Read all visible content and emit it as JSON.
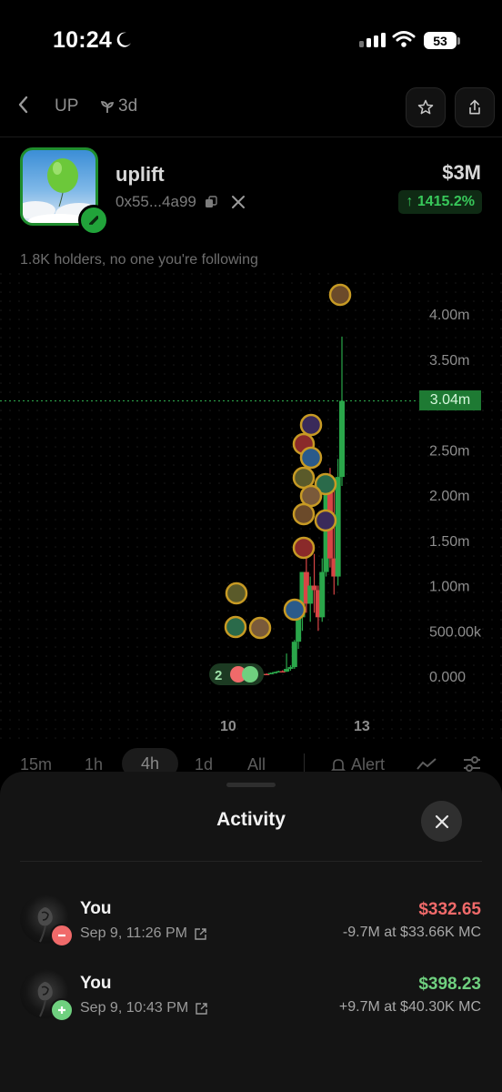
{
  "status_bar": {
    "time": "10:24",
    "battery": "53"
  },
  "nav": {
    "ticker": "UP",
    "age": "3d"
  },
  "token": {
    "name": "uplift",
    "address": "0x55...4a99",
    "market_cap": "$3M",
    "change": "↑ 1415.2%",
    "holders_text": "1.8K holders, no one you're following"
  },
  "chart_data": {
    "type": "candlestick",
    "y_tick_labels": [
      "4.00m",
      "3.50m",
      "3.04m",
      "2.50m",
      "2.00m",
      "1.50m",
      "1.00m",
      "500.00k",
      "0.000"
    ],
    "y_ticks": [
      4000000,
      3500000,
      2500000,
      2000000,
      1500000,
      1000000,
      500000,
      0
    ],
    "current_price": 3040000,
    "current_price_label": "3.04m",
    "x_tick_labels": [
      "10",
      "13"
    ],
    "ylim": [
      0,
      4200000
    ],
    "candles": [
      {
        "o": 20000,
        "h": 30000,
        "l": 15000,
        "c": 25000
      },
      {
        "o": 25000,
        "h": 30000,
        "l": 18000,
        "c": 22000
      },
      {
        "o": 22000,
        "h": 40000,
        "l": 20000,
        "c": 35000
      },
      {
        "o": 35000,
        "h": 50000,
        "l": 30000,
        "c": 45000
      },
      {
        "o": 45000,
        "h": 60000,
        "l": 40000,
        "c": 55000
      },
      {
        "o": 55000,
        "h": 65000,
        "l": 45000,
        "c": 50000
      },
      {
        "o": 50000,
        "h": 250000,
        "l": 45000,
        "c": 80000
      },
      {
        "o": 80000,
        "h": 120000,
        "l": 60000,
        "c": 100000
      },
      {
        "o": 100000,
        "h": 400000,
        "l": 80000,
        "c": 380000
      },
      {
        "o": 380000,
        "h": 700000,
        "l": 300000,
        "c": 650000
      },
      {
        "o": 650000,
        "h": 1150000,
        "l": 500000,
        "c": 1150000
      },
      {
        "o": 1150000,
        "h": 1300000,
        "l": 700000,
        "c": 800000
      },
      {
        "o": 800000,
        "h": 1100000,
        "l": 600000,
        "c": 1000000
      },
      {
        "o": 1000000,
        "h": 1350000,
        "l": 700000,
        "c": 950000
      },
      {
        "o": 950000,
        "h": 1000000,
        "l": 500000,
        "c": 650000
      },
      {
        "o": 650000,
        "h": 1300000,
        "l": 600000,
        "c": 1150000
      },
      {
        "o": 1150000,
        "h": 2100000,
        "l": 1100000,
        "c": 2050000
      },
      {
        "o": 2050000,
        "h": 2300000,
        "l": 1200000,
        "c": 1300000
      },
      {
        "o": 1300000,
        "h": 2100000,
        "l": 900000,
        "c": 1100000
      },
      {
        "o": 1100000,
        "h": 2400000,
        "l": 1000000,
        "c": 2200000
      },
      {
        "o": 2200000,
        "h": 3750000,
        "l": 2100000,
        "c": 3040000
      }
    ],
    "trade_markers": [
      "sell",
      "buy"
    ],
    "trade_marker_count": "2"
  },
  "timeframes": {
    "items": [
      "15m",
      "1h",
      "4h",
      "1d",
      "All"
    ],
    "active": "4h",
    "alert_label": "Alert"
  },
  "activity": {
    "title": "Activity",
    "rows": [
      {
        "user": "You",
        "side": "sell",
        "time": "Sep 9, 11:26 PM",
        "amount": "$332.65",
        "detail": "-9.7M at $33.66K MC",
        "color": "#f06a6a"
      },
      {
        "user": "You",
        "side": "buy",
        "time": "Sep 9, 10:43 PM",
        "amount": "$398.23",
        "detail": "+9.7M at $40.30K MC",
        "color": "#6fd07f"
      }
    ]
  },
  "colors": {
    "accent_green": "#21a33a",
    "up_candle": "#2aa64a",
    "down_candle": "#d84545",
    "sell_red": "#f06a6a",
    "buy_green": "#6fd07f"
  }
}
